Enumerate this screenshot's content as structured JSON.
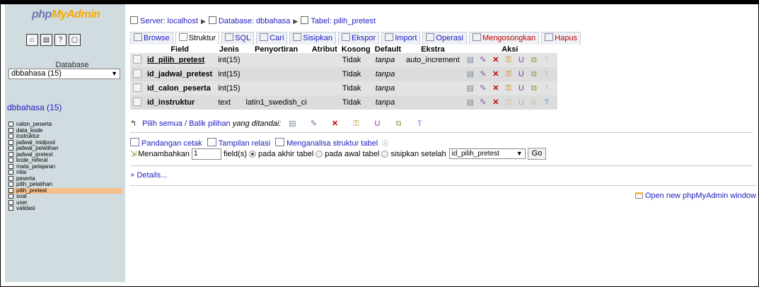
{
  "sidebar": {
    "logo_part1": "php",
    "logo_part2": "MyAdmin",
    "icons": [
      "home-icon",
      "query-window-icon",
      "docs-icon",
      "sql-docs-icon"
    ],
    "database_label": "Database",
    "database_select": "dbbahasa (15)",
    "database_link": "dbbahasa (15)",
    "tables": [
      "calon_peserta",
      "data_kode",
      "instruktur",
      "jadwal_midpost",
      "jadwal_pelatihan",
      "jadwal_pretest",
      "kode_referal",
      "mata_pelajaran",
      "nilai",
      "peserta",
      "pilih_pelatihan",
      "pilih_pretest",
      "soal",
      "user",
      "validasi"
    ],
    "selected_table": "pilih_pretest"
  },
  "breadcrumb": {
    "server": "Server: localhost",
    "database": "Database: dbbahasa",
    "table": "Tabel: pilih_pretest"
  },
  "tabs": [
    {
      "label": "Browse",
      "active": false
    },
    {
      "label": "Struktur",
      "active": true
    },
    {
      "label": "SQL",
      "active": false
    },
    {
      "label": "Cari",
      "active": false
    },
    {
      "label": "Sisipkan",
      "active": false
    },
    {
      "label": "Ekspor",
      "active": false
    },
    {
      "label": "Import",
      "active": false
    },
    {
      "label": "Operasi",
      "active": false
    },
    {
      "label": "Mengosongkan",
      "active": false
    },
    {
      "label": "Hapus",
      "active": false
    }
  ],
  "table": {
    "headers": {
      "field": "Field",
      "jenis": "Jenis",
      "penyortiran": "Penyortiran",
      "atribut": "Atribut",
      "kosong": "Kosong",
      "default": "Default",
      "ekstra": "Ekstra",
      "aksi": "Aksi"
    },
    "rows": [
      {
        "field": "id_pilih_pretest",
        "jenis": "int(15)",
        "penyortiran": "",
        "atribut": "",
        "kosong": "Tidak",
        "default": "tanpa",
        "ekstra": "auto_increment",
        "primary": true
      },
      {
        "field": "id_jadwal_pretest",
        "jenis": "int(15)",
        "penyortiran": "",
        "atribut": "",
        "kosong": "Tidak",
        "default": "tanpa",
        "ekstra": "",
        "primary": false
      },
      {
        "field": "id_calon_peserta",
        "jenis": "int(15)",
        "penyortiran": "",
        "atribut": "",
        "kosong": "Tidak",
        "default": "tanpa",
        "ekstra": "",
        "primary": false
      },
      {
        "field": "id_instruktur",
        "jenis": "text",
        "penyortiran": "latin1_swedish_ci",
        "atribut": "",
        "kosong": "Tidak",
        "default": "tanpa",
        "ekstra": "",
        "primary": false
      }
    ]
  },
  "select_all": "Pilih semua / Balik pilihan",
  "select_all_suffix": "yang ditandai:",
  "options": {
    "print_view": "Pandangan cetak",
    "relation_view": "Tampilan relasi",
    "analyze": "Menganalisa struktur tabel"
  },
  "add_field": {
    "label": "Menambahkan",
    "count": "1",
    "fields_label": "field(s)",
    "opt_end": "pada akhir tabel",
    "opt_begin": "pada awal tabel",
    "opt_after": "sisipkan setelah",
    "after_field": "id_pilih_pretest",
    "go": "Go"
  },
  "details": "+ Details...",
  "new_window": "Open new phpMyAdmin window"
}
